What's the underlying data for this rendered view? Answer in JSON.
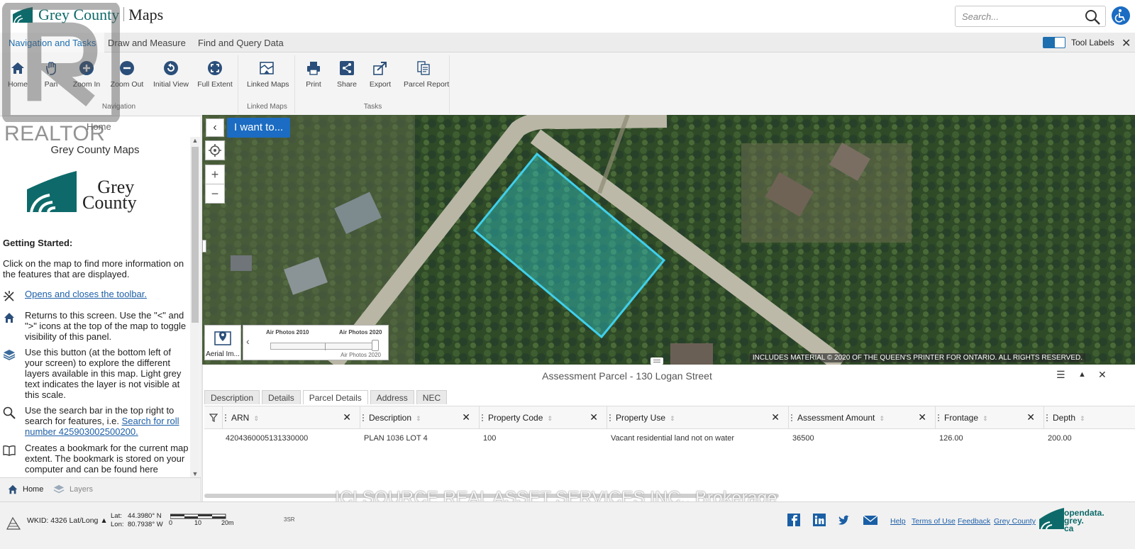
{
  "header": {
    "brand": "Grey County",
    "app_name": "Maps",
    "search_placeholder": "Search..."
  },
  "tabs": [
    {
      "label": "Navigation and Tasks",
      "active": true
    },
    {
      "label": "Draw and Measure",
      "active": false
    },
    {
      "label": "Find and Query Data",
      "active": false
    }
  ],
  "tool_labels": {
    "label": "Tool Labels",
    "checked": true
  },
  "ribbon": {
    "groups": [
      {
        "label": "Navigation",
        "buttons": [
          "Home",
          "Pan",
          "Zoom In",
          "Zoom Out",
          "Initial View",
          "Full Extent"
        ]
      },
      {
        "label": "Linked Maps",
        "buttons": [
          "Linked Maps"
        ]
      },
      {
        "label": "Tasks",
        "buttons": [
          "Print",
          "Share",
          "Export",
          "Parcel Report"
        ]
      }
    ]
  },
  "watermark": {
    "realtor": "REALTOR",
    "brokerage": "ICI SOURCE REAL ASSET SERVICES INC., Brokerage"
  },
  "panel": {
    "breadcrumb": "Home",
    "title": "Grey County Maps",
    "logo_text": [
      "Grey",
      "County"
    ],
    "heading": "Getting Started:",
    "intro": "Click on the map to find more information on the features that are displayed.",
    "items": [
      {
        "icon": "wrench-icon",
        "link": "Opens and closes the toolbar.",
        "text": ""
      },
      {
        "icon": "home-icon",
        "link": "",
        "text": "Returns to this screen. Use the \"<\" and \">\" icons at the top of the map to toggle visibility of this panel."
      },
      {
        "icon": "layers-icon",
        "link": "",
        "text": "Use this button (at the bottom left of your screen) to explore the different layers available in this map. Light grey text indicates the layer is not visible at this scale."
      },
      {
        "icon": "search-icon",
        "text": "Use the search bar in the top right to search for features, i.e. ",
        "link": "Search for roll number 425903002500200."
      },
      {
        "icon": "book-icon",
        "link": "",
        "text": "Creates a bookmark for the current map extent. The bookmark is stored on your computer and can be found here"
      }
    ],
    "tabs": [
      "Home",
      "Layers"
    ]
  },
  "map": {
    "i_want_to": "I want to...",
    "basemap_label": "Aerial Im...",
    "swipe": {
      "left": "Air Photos 2010",
      "right": "Air Photos 2020",
      "current": "Air Photos 2020",
      "position": 1.0
    },
    "attribution": "INCLUDES MATERIAL © 2020 OF THE QUEEN'S PRINTER FOR ONTARIO. ALL RIGHTS RESERVED.",
    "colors": {
      "parcel_outline": "#3fd0ec",
      "parcel_fill": "#2ec4c4"
    }
  },
  "results": {
    "title": "Assessment Parcel - 130 Logan Street",
    "tabs": [
      {
        "label": "Description",
        "active": false
      },
      {
        "label": "Details",
        "active": false
      },
      {
        "label": "Parcel Details",
        "active": true
      },
      {
        "label": "Address",
        "active": false
      },
      {
        "label": "NEC",
        "active": false
      }
    ],
    "columns": [
      "ARN",
      "Description",
      "Property Code",
      "Property Use",
      "Assessment Amount",
      "Frontage",
      "Depth"
    ],
    "rows": [
      [
        "4204360005131330000",
        "PLAN 1036 LOT 4",
        "100",
        "Vacant residential land not on water",
        "36500",
        "126.00",
        "200.00"
      ]
    ]
  },
  "footer": {
    "wkid": "WKID: 4326 Lat/Long ▲",
    "lat_label": "Lat:",
    "lat": "44.3980° N",
    "lon_label": "Lon:",
    "lon": "80.7938° W",
    "scale_labels": [
      "0",
      "10",
      "20m"
    ],
    "overview": "3SR",
    "links": [
      "Help",
      "Terms of Use",
      "Feedback",
      "Grey County"
    ],
    "opendata": [
      "opendata.",
      "grey.",
      "ca"
    ]
  },
  "accent_colors": {
    "primary_blue": "#1b6cc2",
    "brand_teal": "#0e6a6a"
  }
}
